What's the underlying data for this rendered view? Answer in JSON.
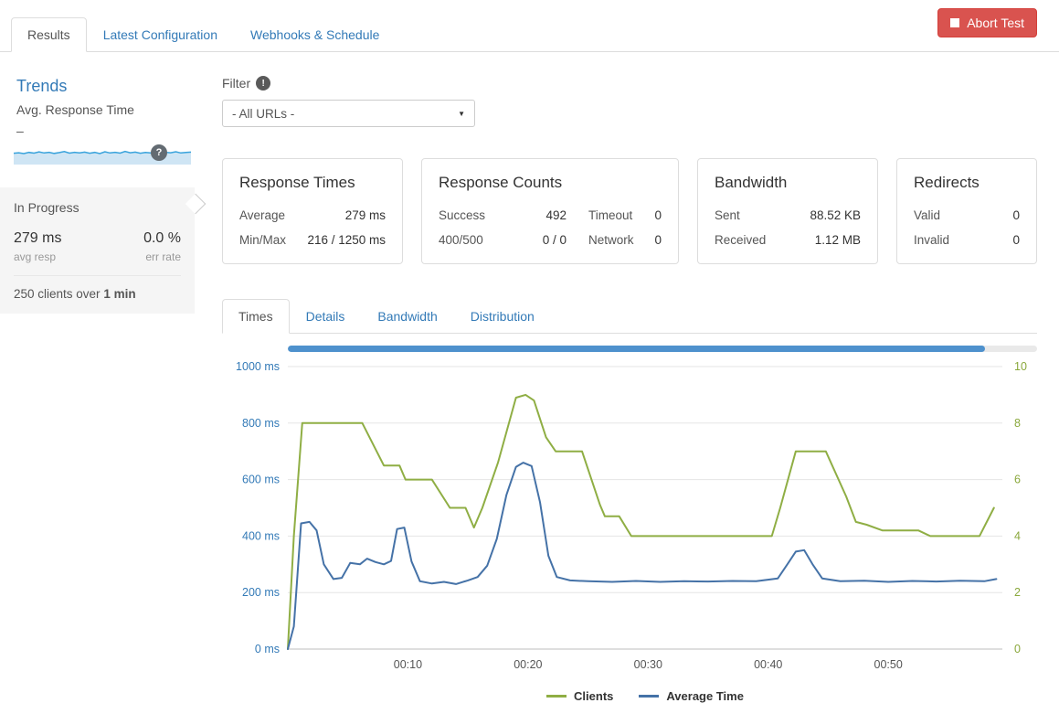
{
  "header": {
    "tabs": [
      {
        "label": "Results",
        "active": true
      },
      {
        "label": "Latest Configuration",
        "active": false
      },
      {
        "label": "Webhooks & Schedule",
        "active": false
      }
    ],
    "abort_label": "Abort Test"
  },
  "icons": {
    "stop": "stop-square",
    "help": "?",
    "info": "!",
    "caret_down": "▼"
  },
  "colors": {
    "accent_link": "#337ab7",
    "abort_red": "#d9534f",
    "clients_green": "#8fae44",
    "avg_time_blue": "#4572a7",
    "sparkline_blue": "#39a3dc",
    "progress_fill": "#4e91cd"
  },
  "sidebar": {
    "trends_title": "Trends",
    "metric_label": "Avg. Response Time",
    "metric_value": "–",
    "sparkline": [
      52,
      55,
      50,
      57,
      53,
      60,
      54,
      58,
      51,
      56,
      62,
      53,
      58,
      54,
      59,
      52,
      57,
      50,
      61,
      54,
      58,
      53,
      63,
      55,
      59,
      52,
      57,
      54,
      60,
      53,
      58,
      55,
      61,
      54,
      57,
      59
    ],
    "progress": {
      "status": "In Progress",
      "avg_value": "279 ms",
      "avg_label": "avg resp",
      "err_value": "0.0 %",
      "err_label": "err rate",
      "summary_prefix": "250 clients over ",
      "summary_bold": "1 min"
    }
  },
  "filter": {
    "label": "Filter",
    "selected": "- All URLs -"
  },
  "cards": [
    {
      "title": "Response Times",
      "rows": [
        {
          "label": "Average",
          "value": "279 ms"
        },
        {
          "label": "Min/Max",
          "value": "216 / 1250 ms"
        }
      ]
    },
    {
      "title": "Response Counts",
      "rows": [
        {
          "label1": "Success",
          "value1": "492",
          "label2": "Timeout",
          "value2": "0"
        },
        {
          "label1": "400/500",
          "value1": "0 / 0",
          "label2": "Network",
          "value2": "0"
        }
      ]
    },
    {
      "title": "Bandwidth",
      "rows": [
        {
          "label": "Sent",
          "value": "88.52 KB"
        },
        {
          "label": "Received",
          "value": "1.12 MB"
        }
      ]
    },
    {
      "title": "Redirects",
      "rows": [
        {
          "label": "Valid",
          "value": "0"
        },
        {
          "label": "Invalid",
          "value": "0"
        }
      ]
    }
  ],
  "chart_tabs": [
    {
      "label": "Times",
      "active": true
    },
    {
      "label": "Details",
      "active": false
    },
    {
      "label": "Bandwidth",
      "active": false
    },
    {
      "label": "Distribution",
      "active": false
    }
  ],
  "test_progress_percent": 93,
  "chart_data": {
    "type": "line",
    "title": "",
    "legend_position": "bottom",
    "grid": true,
    "x_axis": {
      "range_seconds": [
        0,
        59.5
      ],
      "ticks": [
        {
          "t": 10,
          "label": "00:10"
        },
        {
          "t": 20,
          "label": "00:20"
        },
        {
          "t": 30,
          "label": "00:30"
        },
        {
          "t": 40,
          "label": "00:40"
        },
        {
          "t": 50,
          "label": "00:50"
        }
      ]
    },
    "left_axis": {
      "title": "response time (ms)",
      "color": "#337ab7",
      "range": [
        0,
        1000
      ],
      "ticks": [
        {
          "v": 0,
          "label": "0 ms"
        },
        {
          "v": 200,
          "label": "200 ms"
        },
        {
          "v": 400,
          "label": "400 ms"
        },
        {
          "v": 600,
          "label": "600 ms"
        },
        {
          "v": 800,
          "label": "800 ms"
        },
        {
          "v": 1000,
          "label": "1000 ms"
        }
      ]
    },
    "right_axis": {
      "title": "clients",
      "color": "#8aa83c",
      "range": [
        0,
        10
      ],
      "ticks": [
        {
          "v": 0,
          "label": "0"
        },
        {
          "v": 2,
          "label": "2"
        },
        {
          "v": 4,
          "label": "4"
        },
        {
          "v": 6,
          "label": "6"
        },
        {
          "v": 8,
          "label": "8"
        },
        {
          "v": 10,
          "label": "10"
        }
      ]
    },
    "series": [
      {
        "name": "Clients",
        "axis": "right",
        "color": "#8fae44",
        "x": [
          0,
          0.5,
          1.2,
          6.2,
          8,
          9.3,
          9.8,
          12,
          13.5,
          14.8,
          15.5,
          16.2,
          17.5,
          19,
          19.8,
          20.5,
          21.5,
          22.3,
          24.5,
          26,
          26.4,
          27.6,
          28.6,
          40.3,
          41,
          42.3,
          44.8,
          46.5,
          47.3,
          48.2,
          49.5,
          52.5,
          53.5,
          57.6,
          58.8
        ],
        "values": [
          0,
          4,
          8,
          8,
          6.5,
          6.5,
          6,
          6,
          5,
          5,
          4.3,
          5,
          6.6,
          8.9,
          9,
          8.8,
          7.5,
          7,
          7,
          5.1,
          4.7,
          4.7,
          4,
          4,
          5,
          7,
          7,
          5.4,
          4.5,
          4.4,
          4.2,
          4.2,
          4,
          4,
          5
        ]
      },
      {
        "name": "Average Time",
        "axis": "left",
        "color": "#4572a7",
        "x": [
          0,
          0.5,
          1.1,
          1.8,
          2.4,
          3,
          3.8,
          4.5,
          5.2,
          6,
          6.6,
          7.3,
          8,
          8.6,
          9.1,
          9.7,
          10.3,
          11,
          12,
          13,
          14,
          15,
          15.8,
          16.6,
          17.4,
          18.2,
          19,
          19.6,
          20.3,
          21,
          21.7,
          22.4,
          23.5,
          25,
          27,
          29,
          31,
          33,
          35,
          37,
          39,
          40.8,
          41.6,
          42.3,
          43,
          43.7,
          44.5,
          46,
          48,
          50,
          52,
          54,
          56,
          58,
          59
        ],
        "values": [
          0,
          80,
          445,
          450,
          420,
          300,
          248,
          252,
          305,
          300,
          320,
          308,
          300,
          312,
          425,
          430,
          310,
          240,
          232,
          238,
          230,
          243,
          255,
          295,
          390,
          545,
          645,
          660,
          648,
          520,
          330,
          255,
          243,
          240,
          238,
          241,
          238,
          240,
          239,
          241,
          240,
          250,
          300,
          345,
          350,
          300,
          250,
          240,
          242,
          238,
          241,
          239,
          242,
          240,
          248
        ]
      }
    ]
  }
}
